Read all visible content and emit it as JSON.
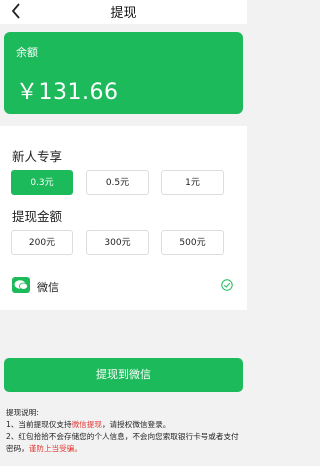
{
  "header": {
    "title": "提现",
    "back_icon": "chevron-left-icon"
  },
  "balance": {
    "label": "余额",
    "amount": "￥131.66"
  },
  "new_user": {
    "title": "新人专享",
    "options": [
      {
        "label": "0.3元",
        "selected": true
      },
      {
        "label": "0.5元",
        "selected": false
      },
      {
        "label": "1元",
        "selected": false
      }
    ]
  },
  "amount_section": {
    "title": "提现金额",
    "options": [
      {
        "label": "200元"
      },
      {
        "label": "300元"
      },
      {
        "label": "500元"
      }
    ]
  },
  "payment": {
    "label": "微信",
    "icon": "wechat-icon",
    "checked": true
  },
  "withdraw_button": "提现到微信",
  "notes": {
    "title": "提现说明:",
    "line1_prefix": "1、当前提现仅支持",
    "line1_highlight": "微信提现",
    "line1_suffix": "，请授权微信登录。",
    "line2_prefix": "2、红包拾拾不会存储您的个人信息，不会向您索取银行卡号或者支付密码，",
    "line2_highlight": "谨防上当受骗。"
  },
  "colors": {
    "accent": "#1dba5c",
    "warning": "#e53935"
  }
}
